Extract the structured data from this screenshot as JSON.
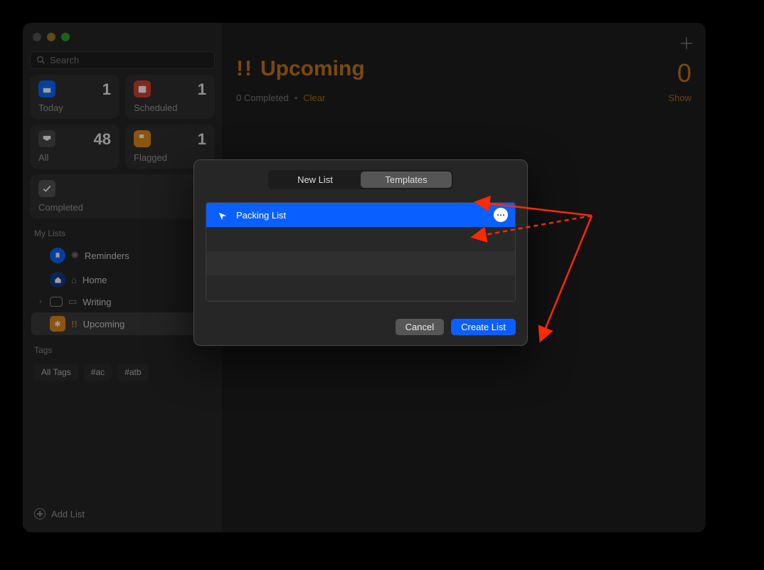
{
  "search": {
    "placeholder": "Search"
  },
  "cards": {
    "today": {
      "label": "Today",
      "count": "1"
    },
    "scheduled": {
      "label": "Scheduled",
      "count": "1"
    },
    "all": {
      "label": "All",
      "count": "48"
    },
    "flagged": {
      "label": "Flagged",
      "count": "1"
    },
    "completed": {
      "label": "Completed"
    }
  },
  "sidebar": {
    "mylists_label": "My Lists",
    "items": [
      {
        "label": "Reminders"
      },
      {
        "label": "Home"
      },
      {
        "label": "Writing"
      },
      {
        "label": "Upcoming",
        "prefix": "!!"
      }
    ],
    "tags_label": "Tags",
    "tags": [
      "All Tags",
      "#ac",
      "#atb"
    ],
    "add_list_label": "Add List"
  },
  "main": {
    "title": "Upcoming",
    "title_prefix": "!!",
    "count": "0",
    "completed_text": "0 Completed",
    "clear_label": "Clear",
    "show_label": "Show"
  },
  "modal": {
    "tabs": {
      "new_list": "New List",
      "templates": "Templates"
    },
    "template_name": "Packing List",
    "cancel": "Cancel",
    "create": "Create List"
  }
}
